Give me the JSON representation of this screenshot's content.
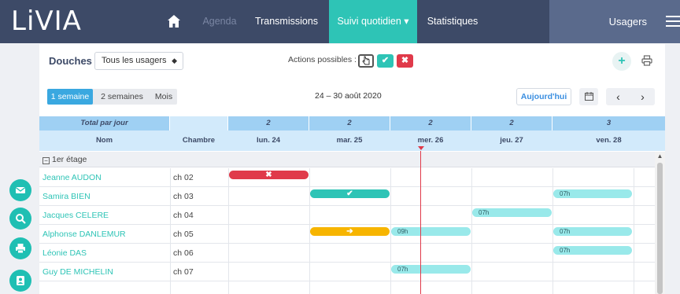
{
  "app": {
    "logo": "LiVIA"
  },
  "nav": {
    "items": [
      {
        "label": "Agenda",
        "state": "disabled"
      },
      {
        "label": "Transmissions",
        "state": "normal"
      },
      {
        "label": "Suivi quotidien ▾",
        "state": "active"
      },
      {
        "label": "Statistiques",
        "state": "normal"
      }
    ],
    "usagers": "Usagers"
  },
  "toolbar": {
    "title": "Douches",
    "filter_value": "Tous les usagers",
    "actions_label": "Actions possibles :",
    "action_ok": "✔",
    "action_no": "✖",
    "add_label": "+"
  },
  "range": {
    "options": [
      "1 semaine",
      "2 semaines",
      "Mois"
    ],
    "selected": "1 semaine",
    "dates": "24 – 30 août 2020",
    "today_label": "Aujourd'hui",
    "prev": "‹",
    "next": "›"
  },
  "grid": {
    "total_label": "Total par jour",
    "col_name": "Nom",
    "col_room": "Chambre",
    "days": [
      {
        "label": "lun. 24",
        "total": "2"
      },
      {
        "label": "mar. 25",
        "total": "2"
      },
      {
        "label": "mer. 26",
        "total": "2"
      },
      {
        "label": "jeu. 27",
        "total": "2"
      },
      {
        "label": "ven. 28",
        "total": "3"
      }
    ],
    "floor": "1er étage",
    "rows": [
      {
        "name": "Jeanne AUDON",
        "room": "ch 02"
      },
      {
        "name": "Samira BIEN",
        "room": "ch 03"
      },
      {
        "name": "Jacques CELERE",
        "room": "ch 04"
      },
      {
        "name": "Alphonse DANLEMUR",
        "room": "ch 05"
      },
      {
        "name": "Léonie DAS",
        "room": "ch 06"
      },
      {
        "name": "Guy DE MICHELIN",
        "room": "ch 07"
      }
    ],
    "events": {
      "audon_mon": "✖",
      "bien_tue": "✔",
      "bien_fri": "07h",
      "celere_thu": "07h",
      "danlemur_tue": "➔",
      "danlemur_wed": "09h",
      "danlemur_fri": "07h",
      "das_fri": "07h",
      "michelin_wed": "07h"
    }
  },
  "colors": {
    "nav_bg": "#3d4a67",
    "accent": "#2ec4b6",
    "danger": "#e03a4a",
    "warning": "#f7b500",
    "scheduled": "#99e9ea",
    "header_blue": "#9fd0f3"
  },
  "side_buttons": [
    "mail-icon",
    "search-icon",
    "print-icon",
    "contact-icon"
  ]
}
